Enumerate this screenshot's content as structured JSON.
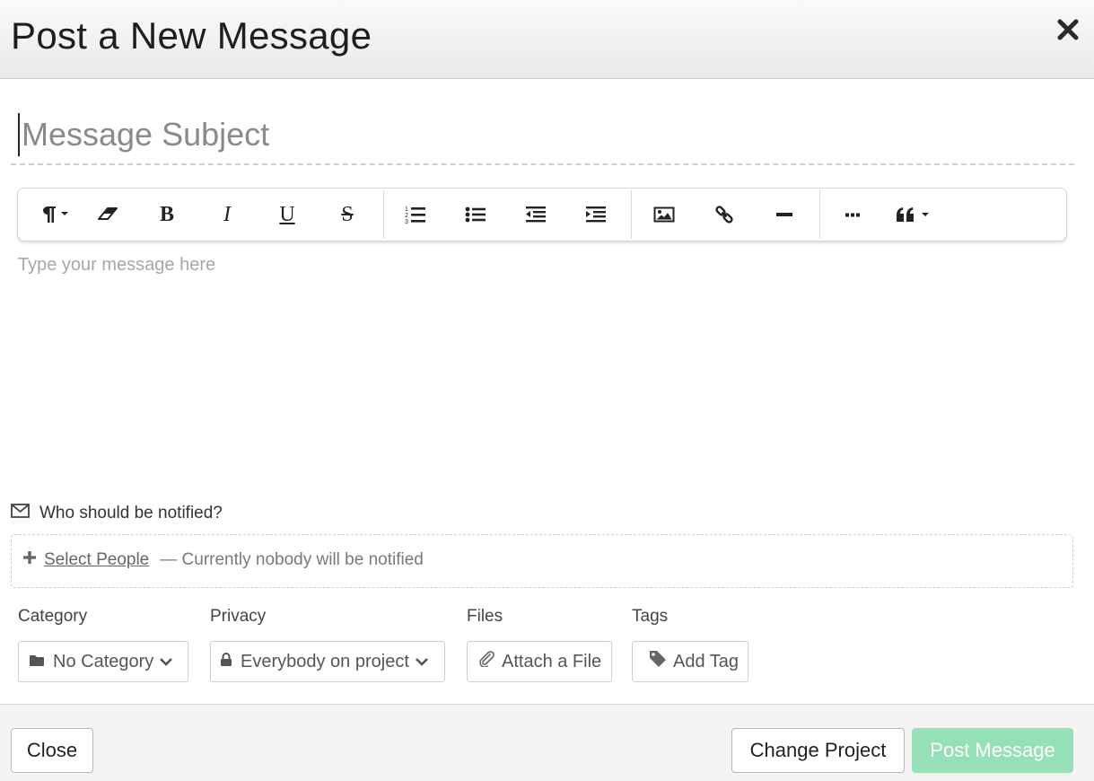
{
  "dialog": {
    "title": "Post a New Message",
    "close_icon": "close-icon"
  },
  "subject": {
    "placeholder": "Message Subject",
    "value": ""
  },
  "toolbar": {
    "buttons": [
      {
        "name": "paragraph-format",
        "icon": "pilcrow-dropdown-icon"
      },
      {
        "name": "clear-formatting",
        "icon": "eraser-icon"
      },
      {
        "name": "bold",
        "label": "B"
      },
      {
        "name": "italic",
        "label": "I"
      },
      {
        "name": "underline",
        "label": "U"
      },
      {
        "name": "strikethrough",
        "label": "S"
      },
      {
        "name": "ordered-list",
        "icon": "ordered-list-icon"
      },
      {
        "name": "unordered-list",
        "icon": "unordered-list-icon"
      },
      {
        "name": "outdent",
        "icon": "outdent-icon"
      },
      {
        "name": "indent",
        "icon": "indent-icon"
      },
      {
        "name": "insert-image",
        "icon": "image-icon"
      },
      {
        "name": "insert-link",
        "icon": "link-icon"
      },
      {
        "name": "horizontal-rule",
        "icon": "minus-icon"
      },
      {
        "name": "more",
        "icon": "ellipsis-icon"
      },
      {
        "name": "quote",
        "icon": "quote-dropdown-icon"
      }
    ]
  },
  "body": {
    "placeholder": "Type your message here",
    "value": ""
  },
  "notify": {
    "label": "Who should be notified?",
    "select_people": "Select People",
    "status": "— Currently nobody will be notified"
  },
  "fields": {
    "category": {
      "label": "Category",
      "value": "No Category"
    },
    "privacy": {
      "label": "Privacy",
      "value": "Everybody on project"
    },
    "files": {
      "label": "Files",
      "button": "Attach a File"
    },
    "tags": {
      "label": "Tags",
      "button": "Add Tag"
    }
  },
  "footer": {
    "close": "Close",
    "change_project": "Change Project",
    "post_message": "Post Message"
  },
  "colors": {
    "primary_button": "#96e0b7",
    "header_bg": "#efefef",
    "placeholder": "#a7a7a7"
  }
}
